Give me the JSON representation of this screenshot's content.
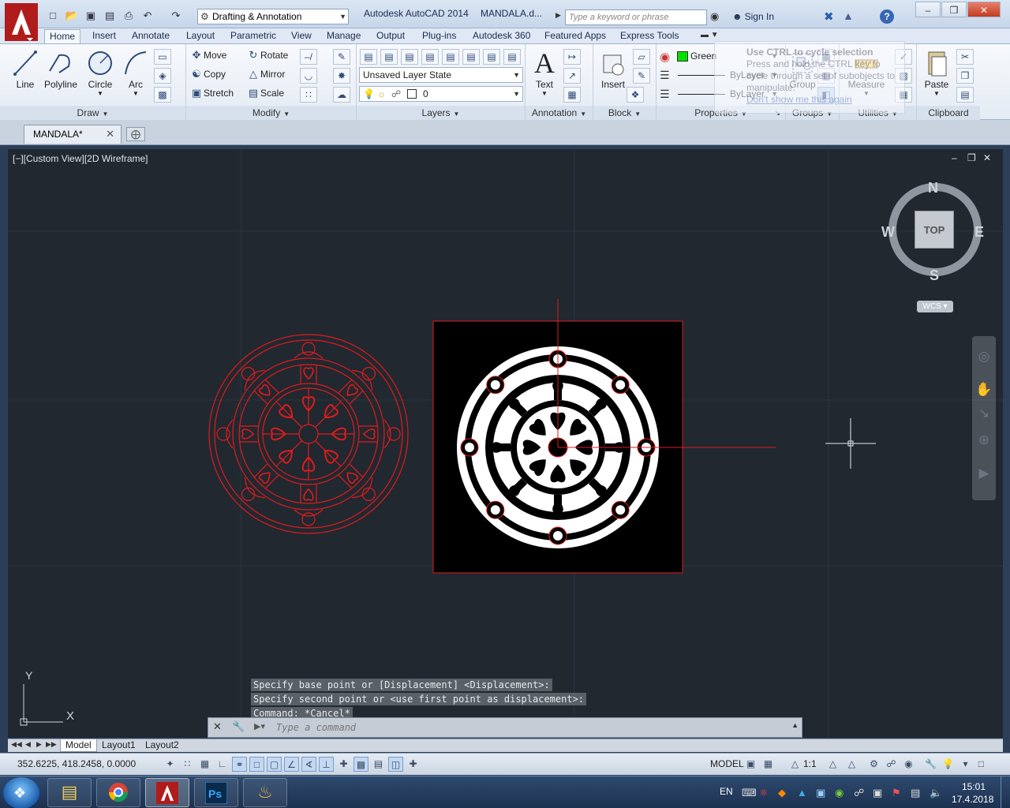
{
  "title_bar": {
    "workspace": "Drafting & Annotation",
    "app_title": "Autodesk AutoCAD 2014",
    "doc_title": "MANDALA.d...",
    "search_placeholder": "Type a keyword or phrase",
    "sign_in": "Sign In"
  },
  "ribbon_tabs": [
    "Home",
    "Insert",
    "Annotate",
    "Layout",
    "Parametric",
    "View",
    "Manage",
    "Output",
    "Plug-ins",
    "Autodesk 360",
    "Featured Apps",
    "Express Tools"
  ],
  "ribbon": {
    "draw": {
      "title": "Draw",
      "line": "Line",
      "polyline": "Polyline",
      "circle": "Circle",
      "arc": "Arc"
    },
    "modify": {
      "title": "Modify",
      "move": "Move",
      "rotate": "Rotate",
      "copy": "Copy",
      "mirror": "Mirror",
      "stretch": "Stretch",
      "scale": "Scale"
    },
    "layers": {
      "title": "Layers",
      "layer_state": "Unsaved Layer State",
      "current_layer": "0"
    },
    "annotation": {
      "title": "Annotation",
      "text": "Text"
    },
    "block": {
      "title": "Block",
      "insert": "Insert"
    },
    "properties": {
      "title": "Properties",
      "color": "Green",
      "linetype": "ByLayer",
      "lineweight": "ByLayer"
    },
    "groups": {
      "title": "Groups",
      "group": "Group"
    },
    "utilities": {
      "title": "Utilities",
      "measure": "Measure"
    },
    "clipboard": {
      "title": "Clipboard",
      "paste": "Paste"
    }
  },
  "tooltip": {
    "title": "Use CTRL to cycle selection",
    "body": "Press and hold the CTRL key to cycle through a set of subobjects to manipulate.",
    "link": "Don't show me this again"
  },
  "document_tab": {
    "name": "MANDALA*"
  },
  "viewport": {
    "label": "[−][Custom View][2D Wireframe]",
    "compass": {
      "n": "N",
      "s": "S",
      "e": "E",
      "w": "W",
      "face": "TOP"
    },
    "wcs": "WCS",
    "ucs_x": "X",
    "ucs_y": "Y"
  },
  "command_line": {
    "history": [
      "Specify base point or [Displacement] <Displacement>:",
      "Specify second point or <use first point as displacement>:",
      "Command: *Cancel*"
    ],
    "placeholder": "Type a command"
  },
  "layout_tabs": [
    "Model",
    "Layout1",
    "Layout2"
  ],
  "status_bar": {
    "coordinates": "352.6225, 418.2458, 0.0000",
    "model": "MODEL",
    "annotation_scale": "1:1"
  },
  "taskbar": {
    "apps": [
      "explorer-icon",
      "chrome-icon",
      "autocad-icon",
      "photoshop-icon",
      "paint-icon"
    ],
    "language": "EN",
    "time": "15:01",
    "date": "17.4.2018"
  },
  "colors": {
    "drawing_red": "#e01b1b",
    "viewport_bg": "#212830",
    "accent_blue": "#3667b5"
  }
}
